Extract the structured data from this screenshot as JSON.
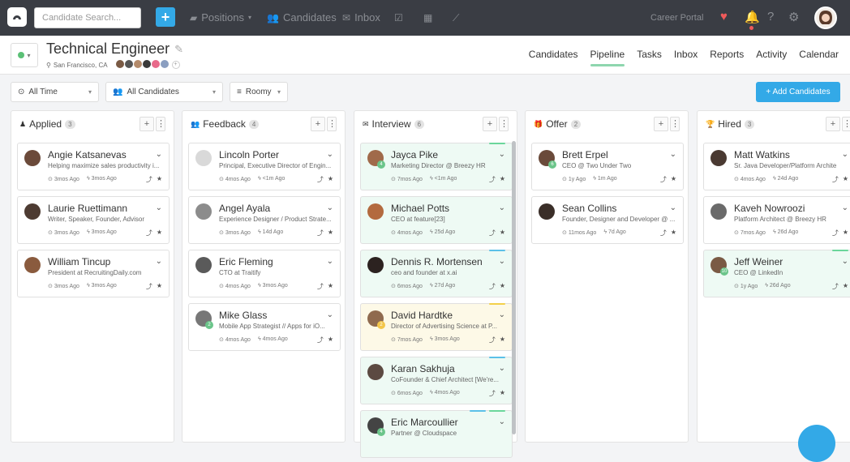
{
  "topnav": {
    "search_placeholder": "Candidate Search...",
    "plus_label": "+",
    "links": [
      {
        "label": "Positions",
        "icon": "briefcase-icon"
      },
      {
        "label": "Candidates",
        "icon": "users-icon"
      },
      {
        "label": "Inbox",
        "icon": "envelope-icon"
      }
    ],
    "career_portal": "Career Portal",
    "right_icons": [
      "heart-icon",
      "bell-icon",
      "help-icon",
      "gear-icon"
    ]
  },
  "position": {
    "title": "Technical Engineer",
    "location": "San Francisco, CA",
    "team_more": "+",
    "tabs": [
      "Candidates",
      "Pipeline",
      "Tasks",
      "Inbox",
      "Reports",
      "Activity",
      "Calendar"
    ],
    "active_tab": "Pipeline"
  },
  "filters": {
    "time": "All Time",
    "candidates": "All Candidates",
    "view": "Roomy",
    "add_button": "+ Add Candidates"
  },
  "columns": [
    {
      "name": "Applied",
      "count": "3",
      "icon": "user-icon",
      "cards": [
        {
          "name": "Angie Katsanevas",
          "title": "Helping maximize sales productivity i...",
          "added": "3mos Ago",
          "activity": "3mos Ago",
          "avatar": "#6b4a3a",
          "badge": "",
          "tint": "",
          "bars": []
        },
        {
          "name": "Laurie Ruettimann",
          "title": "Writer, Speaker, Founder, Advisor",
          "added": "3mos Ago",
          "activity": "3mos Ago",
          "avatar": "#4d3b32",
          "badge": "",
          "tint": "",
          "bars": []
        },
        {
          "name": "William Tincup",
          "title": "President at RecruitingDaily.com",
          "added": "3mos Ago",
          "activity": "3mos Ago",
          "avatar": "#8a5b3e",
          "badge": "",
          "tint": "",
          "bars": []
        }
      ]
    },
    {
      "name": "Feedback",
      "count": "4",
      "icon": "users-icon",
      "cards": [
        {
          "name": "Lincoln Porter",
          "title": "Principal, Executive Director of Engin...",
          "added": "4mos Ago",
          "activity": "<1m Ago",
          "avatar": "#d9d9d9",
          "badge": "",
          "tint": "",
          "bars": []
        },
        {
          "name": "Angel Ayala",
          "title": "Experience Designer / Product Strate...",
          "added": "3mos Ago",
          "activity": "14d Ago",
          "avatar": "#8c8c8c",
          "badge": "",
          "tint": "",
          "bars": []
        },
        {
          "name": "Eric Fleming",
          "title": "CTO at Traitify",
          "added": "4mos Ago",
          "activity": "3mos Ago",
          "avatar": "#5a5a5a",
          "badge": "",
          "tint": "",
          "bars": []
        },
        {
          "name": "Mike Glass",
          "title": "Mobile App Strategist // Apps for iO...",
          "added": "4mos Ago",
          "activity": "4mos Ago",
          "avatar": "#777",
          "badge": "2",
          "tint": "",
          "bars": []
        }
      ]
    },
    {
      "name": "Interview",
      "count": "6",
      "icon": "comment-icon",
      "cards": [
        {
          "name": "Jayca Pike",
          "title": "Marketing Director @ Breezy HR",
          "added": "7mos Ago",
          "activity": "<1m Ago",
          "avatar": "#a06a4a",
          "badge": "4",
          "tint": "green",
          "bars": [
            "#6bd69b"
          ]
        },
        {
          "name": "Michael Potts",
          "title": "CEO at feature[23]",
          "added": "4mos Ago",
          "activity": "25d Ago",
          "avatar": "#b36a3f",
          "badge": "",
          "tint": "green",
          "bars": []
        },
        {
          "name": "Dennis R. Mortensen",
          "title": "ceo and founder at x.ai",
          "added": "6mos Ago",
          "activity": "27d Ago",
          "avatar": "#2c2220",
          "badge": "",
          "tint": "green",
          "bars": [
            "#5bc0e8"
          ]
        },
        {
          "name": "David Hardtke",
          "title": "Director of Advertising Science at P...",
          "added": "7mos Ago",
          "activity": "3mos Ago",
          "avatar": "#8f6a4e",
          "badge": "2",
          "badge_type": "y",
          "tint": "yellow",
          "bars": [
            "#f3d04a"
          ]
        },
        {
          "name": "Karan Sakhuja",
          "title": "CoFounder & Chief Architect [We're...",
          "added": "6mos Ago",
          "activity": "4mos Ago",
          "avatar": "#5c4a42",
          "badge": "",
          "tint": "green",
          "bars": [
            "#5bc0e8"
          ]
        },
        {
          "name": "Eric Marcoullier",
          "title": "Partner @ Cloudspace",
          "added": "",
          "activity": "",
          "avatar": "#444",
          "badge": "4",
          "tint": "green",
          "bars": [
            "#5bc0e8",
            "#6bd69b"
          ]
        }
      ]
    },
    {
      "name": "Offer",
      "count": "2",
      "icon": "gift-icon",
      "cards": [
        {
          "name": "Brett Erpel",
          "title": "CEO @ Two Under Two",
          "added": "1y Ago",
          "activity": "1m Ago",
          "avatar": "#6a4a3a",
          "badge": "6",
          "tint": "",
          "bars": []
        },
        {
          "name": "Sean Collins",
          "title": "Founder, Designer and Developer @ ...",
          "added": "11mos Ago",
          "activity": "7d Ago",
          "avatar": "#3a2e28",
          "badge": "",
          "tint": "",
          "bars": []
        }
      ]
    },
    {
      "name": "Hired",
      "count": "3",
      "icon": "trophy-icon",
      "cards": [
        {
          "name": "Matt Watkins",
          "title": "Sr. Java Developer/Platform Archite",
          "added": "4mos Ago",
          "activity": "24d Ago",
          "avatar": "#4a3a32",
          "badge": "",
          "tint": "",
          "bars": []
        },
        {
          "name": "Kaveh Nowroozi",
          "title": "Platform Architect @ Breezy HR",
          "added": "7mos Ago",
          "activity": "26d Ago",
          "avatar": "#6a6a6a",
          "badge": "",
          "tint": "",
          "bars": []
        },
        {
          "name": "Jeff Weiner",
          "title": "CEO @ LinkedIn",
          "added": "1y Ago",
          "activity": "26d Ago",
          "avatar": "#7a5a44",
          "badge": "10",
          "tint": "green",
          "bars": [
            "#6bd69b"
          ]
        }
      ]
    }
  ]
}
